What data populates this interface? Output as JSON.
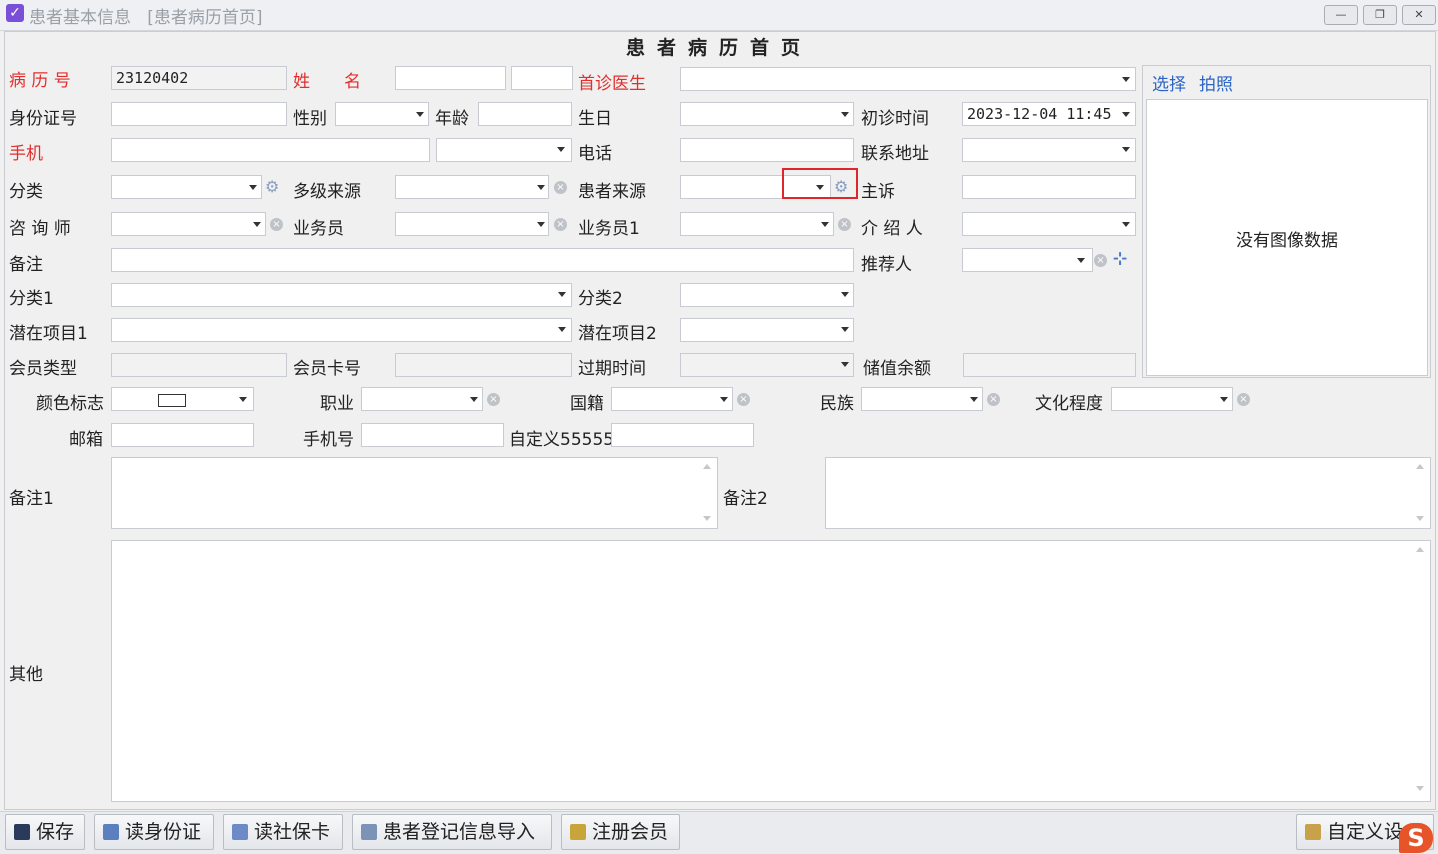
{
  "window": {
    "title": "患者基本信息",
    "tab": "[患者病历首页]",
    "minimize_label": "—",
    "restore_label": "❐",
    "close_label": "✕"
  },
  "form": {
    "heading": "患者病历首页",
    "case_number": {
      "label": "病 历 号",
      "value": "23120402"
    },
    "name": {
      "label": "姓　　名",
      "value": "",
      "value2": ""
    },
    "first_doctor": {
      "label": "首诊医生",
      "value": ""
    },
    "id_number": {
      "label": "身份证号",
      "value": ""
    },
    "gender": {
      "label": "性别",
      "value": ""
    },
    "age": {
      "label": "年龄",
      "value": ""
    },
    "birthday": {
      "label": "生日",
      "value": ""
    },
    "first_visit_time": {
      "label": "初诊时间",
      "value": "2023-12-04 11:45"
    },
    "mobile": {
      "label": "手机",
      "value": "",
      "type_value": ""
    },
    "phone": {
      "label": "电话",
      "value": ""
    },
    "address": {
      "label": "联系地址",
      "value": ""
    },
    "category": {
      "label": "分类",
      "value": ""
    },
    "multi_source": {
      "label": "多级来源",
      "value": ""
    },
    "patient_source": {
      "label": "患者来源",
      "value": ""
    },
    "complaint": {
      "label": "主诉",
      "value": ""
    },
    "consultant": {
      "label": "咨 询 师",
      "value": ""
    },
    "salesman": {
      "label": "业务员",
      "value": ""
    },
    "salesman1": {
      "label": "业务员1",
      "value": ""
    },
    "introducer": {
      "label": "介 绍 人",
      "value": ""
    },
    "remark": {
      "label": "备注",
      "value": ""
    },
    "referrer": {
      "label": "推荐人",
      "value": ""
    },
    "category1": {
      "label": "分类1",
      "value": ""
    },
    "category2": {
      "label": "分类2",
      "value": ""
    },
    "potential1": {
      "label": "潜在项目1",
      "value": ""
    },
    "potential2": {
      "label": "潜在项目2",
      "value": ""
    },
    "member_type": {
      "label": "会员类型",
      "value": ""
    },
    "member_card": {
      "label": "会员卡号",
      "value": ""
    },
    "expire_time": {
      "label": "过期时间",
      "value": ""
    },
    "balance": {
      "label": "储值余额",
      "value": ""
    },
    "color_flag": {
      "label": "颜色标志"
    },
    "occupation": {
      "label": "职业",
      "value": ""
    },
    "nationality": {
      "label": "国籍",
      "value": ""
    },
    "ethnicity": {
      "label": "民族",
      "value": ""
    },
    "education": {
      "label": "文化程度",
      "value": ""
    },
    "email": {
      "label": "邮箱",
      "value": ""
    },
    "mobile_no": {
      "label": "手机号",
      "value": ""
    },
    "custom55555": {
      "label": "自定义55555",
      "value": ""
    },
    "remark1": {
      "label": "备注1",
      "value": ""
    },
    "remark2": {
      "label": "备注2",
      "value": ""
    },
    "other": {
      "label": "其他",
      "value": ""
    }
  },
  "photo": {
    "select_label": "选择",
    "capture_label": "拍照",
    "empty_text": "没有图像数据"
  },
  "toolbar": {
    "save": "保存",
    "read_id": "读身份证",
    "read_social": "读社保卡",
    "import_registration": "患者登记信息导入",
    "register_member": "注册会员",
    "custom": "自定义设"
  },
  "icons": {
    "dropdown": "chevron-down-icon",
    "clear": "clear-circle-icon",
    "settings": "gear-icon",
    "add": "plus-icon"
  },
  "colors": {
    "required_label": "#e0302e",
    "link": "#2b64c5",
    "highlight_box": "#e0262d"
  }
}
